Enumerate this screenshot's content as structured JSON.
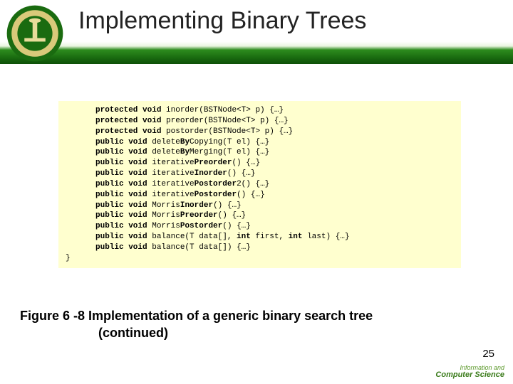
{
  "header": {
    "title": "Implementing Binary Trees"
  },
  "code": {
    "lines": [
      {
        "indent": 1,
        "k1": "protected void",
        "rest": " inorder(BSTNode<T> p) {…}"
      },
      {
        "indent": 1,
        "k1": "protected void",
        "rest": " preorder(BSTNode<T> p) {…}"
      },
      {
        "indent": 1,
        "k1": "protected void",
        "rest": " postorder(BSTNode<T> p) {…}"
      },
      {
        "indent": 1,
        "k1": "public void",
        "rest": " delete",
        "k2": "By",
        "rest2": "Copying(T el) {…}"
      },
      {
        "indent": 1,
        "k1": "public void",
        "rest": " delete",
        "k2": "By",
        "rest2": "Merging(T el) {…}"
      },
      {
        "indent": 1,
        "k1": "public void",
        "rest": " iterative",
        "k2": "Preorder",
        "rest2": "() {…}"
      },
      {
        "indent": 1,
        "k1": "public void",
        "rest": " iterative",
        "k2": "Inorder",
        "rest2": "() {…}"
      },
      {
        "indent": 1,
        "k1": "public void",
        "rest": " iterative",
        "k2": "Postorder",
        "rest2": "2() {…}"
      },
      {
        "indent": 1,
        "k1": "public void",
        "rest": " iterative",
        "k2": "Postorder",
        "rest2": "() {…}"
      },
      {
        "indent": 1,
        "k1": "public void",
        "rest": " Morris",
        "k2": "Inorder",
        "rest2": "() {…}"
      },
      {
        "indent": 1,
        "k1": "public void",
        "rest": " Morris",
        "k2": "Preorder",
        "rest2": "() {…}"
      },
      {
        "indent": 1,
        "k1": "public void",
        "rest": " Morris",
        "k2": "Postorder",
        "rest2": "() {…}"
      },
      {
        "indent": 1,
        "k1": "public void",
        "rest": " balance(T data[], ",
        "k2": "int",
        "rest2": " first, ",
        "k3": "int",
        "rest3": " last) {…}"
      },
      {
        "indent": 1,
        "k1": "public void",
        "rest": " balance(T data[]) {…}"
      },
      {
        "indent": 0,
        "k1": "",
        "rest": "}"
      }
    ]
  },
  "caption": {
    "line1": "Figure 6 -8 Implementation of a generic binary search tree",
    "line2": "(continued)"
  },
  "footer": {
    "l1": "Information and",
    "l2": "Computer Science"
  },
  "page": "25"
}
